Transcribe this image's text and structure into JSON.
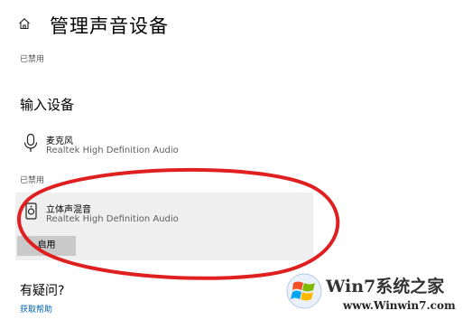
{
  "header": {
    "title": "管理声音设备"
  },
  "output_section": {
    "status_label": "已禁用"
  },
  "input_section": {
    "title": "输入设备",
    "enabled_device": {
      "name": "麦克风",
      "driver": "Realtek High Definition Audio"
    },
    "disabled_label": "已禁用",
    "disabled_device": {
      "name": "立体声混音",
      "driver": "Realtek High Definition Audio",
      "enable_label": "启用"
    }
  },
  "help": {
    "title": "有疑问?",
    "link": "获取帮助"
  },
  "watermark": {
    "brand": "Win7系统之家",
    "url": "www.Winwin7.com"
  },
  "colors": {
    "annotation_red": "#e02020",
    "link_blue": "#0063b1",
    "selected_bg": "#efefef"
  }
}
